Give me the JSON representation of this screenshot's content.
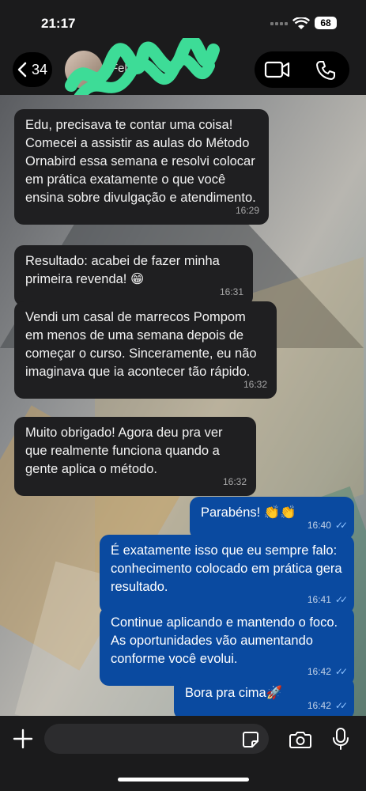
{
  "status": {
    "time": "21:17",
    "battery": "68"
  },
  "header": {
    "back_count": "34",
    "contact_name": "Felicio"
  },
  "messages": [
    {
      "dir": "in",
      "text": "Edu, precisava te contar uma coisa! Comecei a assistir as aulas do Método Ornabird essa semana e resolvi colocar em prática exatamente o que você ensina sobre divulgação e atendimento.",
      "time": "16:29"
    },
    {
      "dir": "in",
      "text": "Resultado: acabei de fazer minha primeira revenda! 😁",
      "time": "16:31"
    },
    {
      "dir": "in",
      "text": "Vendi um casal de marrecos Pompom em menos de uma semana depois de começar o curso. Sinceramente, eu não imaginava que ia acontecer tão rápido.",
      "time": "16:32"
    },
    {
      "dir": "in",
      "text": "Muito obrigado! Agora deu pra ver que realmente funciona quando a gente aplica o método.",
      "time": "16:32"
    },
    {
      "dir": "out",
      "text": "Parabéns! 👏👏",
      "time": "16:40"
    },
    {
      "dir": "out",
      "text": "É exatamente isso que eu sempre falo: conhecimento colocado em prática gera resultado.",
      "time": "16:41"
    },
    {
      "dir": "out",
      "text": "Continue aplicando e mantendo o foco. As oportunidades vão aumentando conforme você evolui.",
      "time": "16:42"
    },
    {
      "dir": "out",
      "text": "Bora pra cima🚀",
      "time": "16:42"
    }
  ],
  "colors": {
    "incoming_bubble": "#1f1f21",
    "outgoing_bubble": "#0a4aa0",
    "read_ticks": "#8fc2ff"
  },
  "icons": [
    "back-chevron-icon",
    "video-call-icon",
    "phone-icon",
    "plus-icon",
    "sticker-icon",
    "camera-icon",
    "microphone-icon"
  ]
}
